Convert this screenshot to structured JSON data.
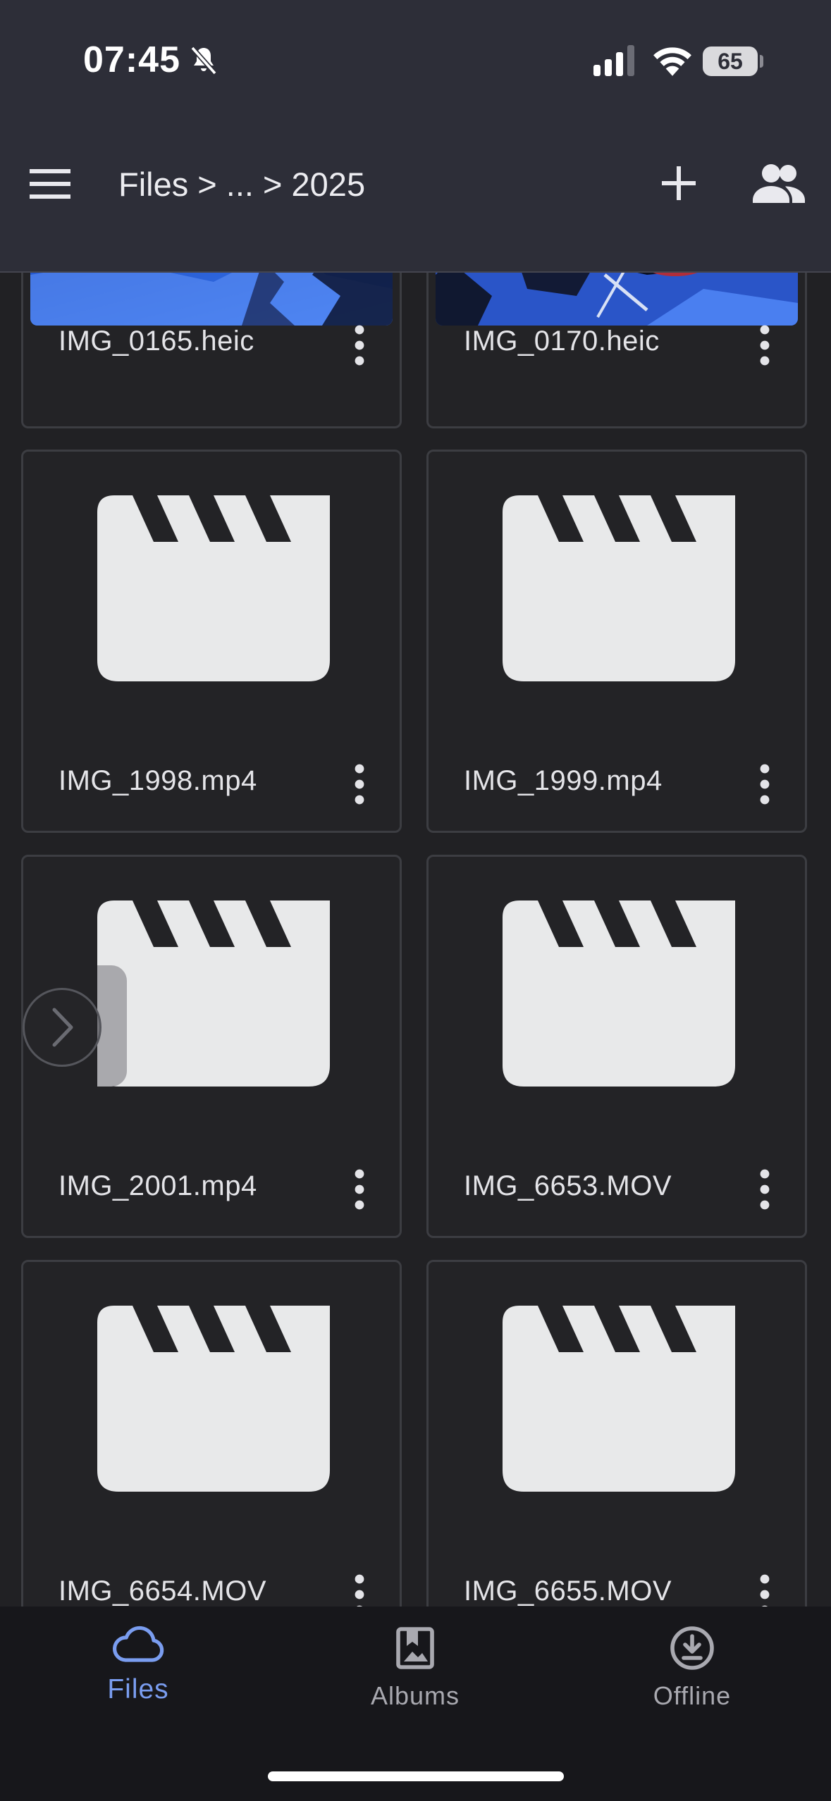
{
  "status_bar": {
    "time": "07:45",
    "battery": "65",
    "icons": [
      "bell-slash-icon",
      "cellular-signal-icon",
      "wifi-icon",
      "battery-icon"
    ]
  },
  "header": {
    "breadcrumb": "Files > ... > 2025",
    "menu_icon": "hamburger-menu-icon",
    "add_icon": "plus-icon",
    "share_icon": "people-icon"
  },
  "files": [
    {
      "name": "IMG_0165.heic",
      "type": "image"
    },
    {
      "name": "IMG_0170.heic",
      "type": "image"
    },
    {
      "name": "IMG_1998.mp4",
      "type": "video"
    },
    {
      "name": "IMG_1999.mp4",
      "type": "video"
    },
    {
      "name": "IMG_2001.mp4",
      "type": "video"
    },
    {
      "name": "IMG_6653.MOV",
      "type": "video"
    },
    {
      "name": "IMG_6654.MOV",
      "type": "video"
    },
    {
      "name": "IMG_6655.MOV",
      "type": "video"
    }
  ],
  "bottom_nav": {
    "items": [
      {
        "label": "Files",
        "icon": "cloud-icon",
        "active": true
      },
      {
        "label": "Albums",
        "icon": "album-bookmark-icon",
        "active": false
      },
      {
        "label": "Offline",
        "icon": "download-circle-icon",
        "active": false
      }
    ]
  },
  "colors": {
    "header_bg": "#2d2e38",
    "page_bg": "#212124",
    "nav_bg": "#17171b",
    "accent": "#7a9df0",
    "icon_fill": "#e8e9ea"
  }
}
